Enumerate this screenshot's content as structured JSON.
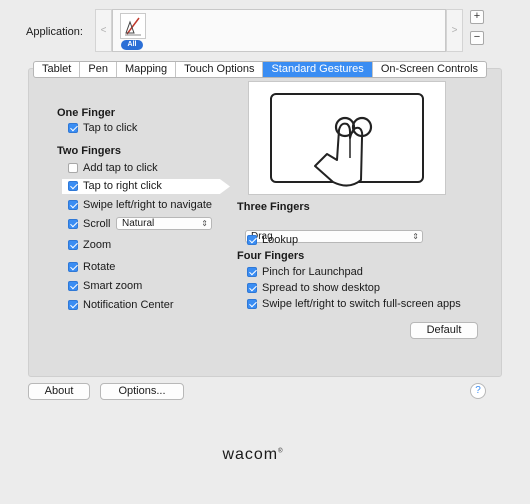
{
  "application": {
    "label": "Application:",
    "prev_arrow": "<",
    "next_arrow": ">",
    "all_badge": "All",
    "add_symbol": "+",
    "remove_symbol": "−"
  },
  "tabs": [
    {
      "label": "Tablet",
      "active": false
    },
    {
      "label": "Pen",
      "active": false
    },
    {
      "label": "Mapping",
      "active": false
    },
    {
      "label": "Touch Options",
      "active": false
    },
    {
      "label": "Standard Gestures",
      "active": true
    },
    {
      "label": "On-Screen Controls",
      "active": false
    }
  ],
  "one_finger": {
    "title": "One Finger",
    "tap_to_click": {
      "label": "Tap to click",
      "checked": true
    }
  },
  "two_fingers": {
    "title": "Two Fingers",
    "add_tap_to_click": {
      "label": "Add tap to click",
      "checked": false
    },
    "tap_to_right_click": {
      "label": "Tap to right click",
      "checked": true
    },
    "swipe_navigate": {
      "label": "Swipe left/right to navigate",
      "checked": true
    },
    "scroll": {
      "label": "Scroll",
      "checked": true,
      "direction": "Natural"
    },
    "zoom": {
      "label": "Zoom",
      "checked": true
    },
    "rotate": {
      "label": "Rotate",
      "checked": true
    },
    "smart_zoom": {
      "label": "Smart zoom",
      "checked": true
    },
    "notification_center": {
      "label": "Notification Center",
      "checked": true
    }
  },
  "three_fingers": {
    "title": "Three Fingers",
    "action": "Drag",
    "lookup": {
      "label": "Lookup",
      "checked": true
    }
  },
  "four_fingers": {
    "title": "Four Fingers",
    "pinch_launchpad": {
      "label": "Pinch for Launchpad",
      "checked": true
    },
    "spread_desktop": {
      "label": "Spread to show desktop",
      "checked": true
    },
    "swipe_fullscreen": {
      "label": "Swipe left/right to switch full-screen apps",
      "checked": true
    }
  },
  "buttons": {
    "default": "Default",
    "about": "About",
    "options": "Options...",
    "help": "?"
  },
  "brand": {
    "logo_text": "wacom",
    "trademark": "®"
  },
  "colors": {
    "accent": "#3a8df3",
    "badge": "#2b6fd6"
  }
}
